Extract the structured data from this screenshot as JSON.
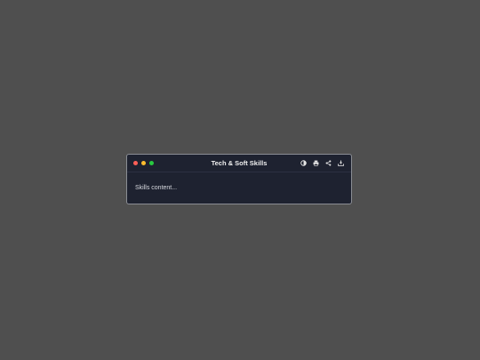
{
  "window": {
    "title": "Tech & Soft Skills",
    "traffic_lights": {
      "close_color": "#ff5f57",
      "minimize_color": "#febc2e",
      "zoom_color": "#28c840"
    },
    "actions": [
      {
        "icon": "contrast-icon"
      },
      {
        "icon": "print-icon"
      },
      {
        "icon": "share-icon"
      },
      {
        "icon": "download-icon"
      }
    ],
    "content_text": "Skills content..."
  },
  "colors": {
    "desktop": "#4f4f4f",
    "window_bg": "#1e2230",
    "title_text": "#f0f0f0"
  }
}
